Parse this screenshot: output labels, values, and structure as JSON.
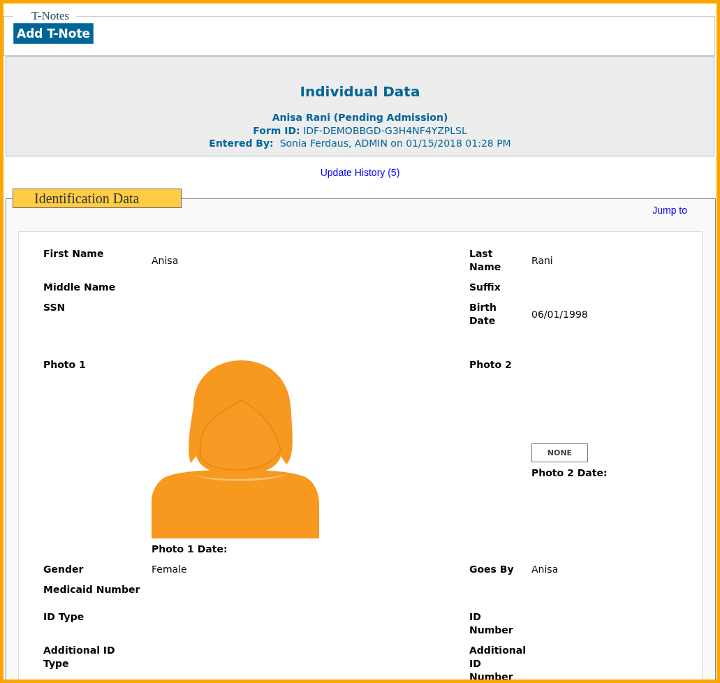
{
  "t_notes": {
    "legend": "T-Notes",
    "button": "Add T-Note"
  },
  "header": {
    "title": "Individual Data",
    "name": "Anisa Rani (Pending Admission)",
    "form_id": {
      "label": "Form ID:",
      "value": "IDF-DEMOBBGD-G3H4NF4YZPLSL"
    },
    "entered_by": {
      "label": "Entered By:",
      "value": "Sonia Ferdaus, ADMIN on 01/15/2018 01:28 PM"
    }
  },
  "update_history_link": "Update History (5)",
  "identification": {
    "legend": "Identification Data",
    "jump_link": "Jump to",
    "rows": [
      {
        "kind": "text",
        "left": {
          "label": "First Name",
          "value": "Anisa"
        },
        "right": {
          "label": "Last Name",
          "value": "Rani"
        }
      },
      {
        "kind": "text",
        "left": {
          "label": "Middle Name"
        },
        "right": {
          "label": "Suffix"
        }
      },
      {
        "kind": "text",
        "left": {
          "label": "SSN"
        },
        "right": {
          "label": "Birth Date",
          "value": "06/01/1998"
        }
      },
      {
        "kind": "photo",
        "left": {
          "label": "Photo 1",
          "kind": "photo",
          "date_label": "Photo 1 Date:"
        },
        "right": {
          "label": "Photo 2",
          "kind": "no_photo",
          "image_text": "NONE",
          "date_label": "Photo 2 Date:"
        }
      },
      {
        "kind": "text",
        "left": {
          "label": "Gender",
          "value": "Female"
        },
        "right": {
          "label": "Goes By",
          "value": "Anisa"
        }
      },
      {
        "kind": "text",
        "left": {
          "label": "Medicaid Number"
        }
      },
      {
        "kind": "spaced",
        "left": {
          "label": "ID Type"
        },
        "right": {
          "label": "ID Number"
        }
      },
      {
        "kind": "text",
        "left": {
          "label": "Additional ID Type"
        },
        "right": {
          "label": "Additional ID Number"
        }
      }
    ]
  }
}
